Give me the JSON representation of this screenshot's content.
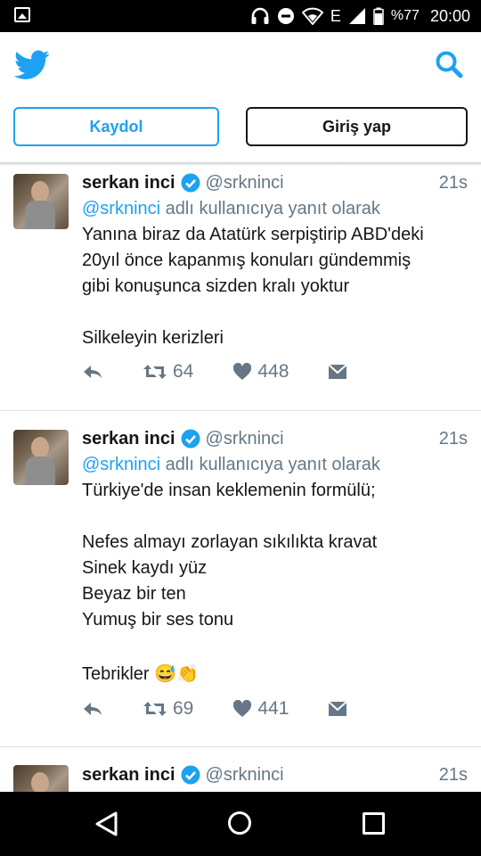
{
  "status_bar": {
    "battery_percent": "%77",
    "time": "20:00",
    "network": "E",
    "icons": [
      "gallery-icon",
      "headset-icon",
      "dnd-icon",
      "wifi-icon",
      "signal-icon",
      "battery-icon"
    ]
  },
  "header": {
    "logo_icon": "twitter-bird-icon",
    "search_icon": "search-icon",
    "signup_label": "Kaydol",
    "login_label": "Giriş yap",
    "accent_color": "#1da1f2"
  },
  "tweets": [
    {
      "name": "serkan inci",
      "handle": "@srkninci",
      "time": "21s",
      "reply_link": "@srkninci",
      "reply_text": " adlı kullanıcıya yanıt olarak",
      "lines": [
        "Yanına biraz da Atatürk serpiştirip ABD'deki",
        "20yıl önce kapanmış konuları gündemmiş",
        "gibi konuşunca sizden kralı yoktur",
        "",
        "Silkeleyin kerizleri"
      ],
      "retweets": "64",
      "likes": "448"
    },
    {
      "name": "serkan inci",
      "handle": "@srkninci",
      "time": "21s",
      "reply_link": "@srkninci",
      "reply_text": " adlı kullanıcıya yanıt olarak",
      "lines": [
        "Türkiye'de insan keklemenin formülü;",
        "",
        "Nefes almayı zorlayan sıkılıkta kravat",
        "Sinek kaydı yüz",
        "Beyaz bir ten",
        "Yumuş bir ses tonu",
        "",
        "Tebrikler 😅👏"
      ],
      "retweets": "69",
      "likes": "441"
    },
    {
      "name": "serkan inci",
      "handle": "@srkninci",
      "time": "21s"
    }
  ],
  "nav_bar": {
    "icons": [
      "back-icon",
      "home-icon",
      "recents-icon"
    ]
  }
}
